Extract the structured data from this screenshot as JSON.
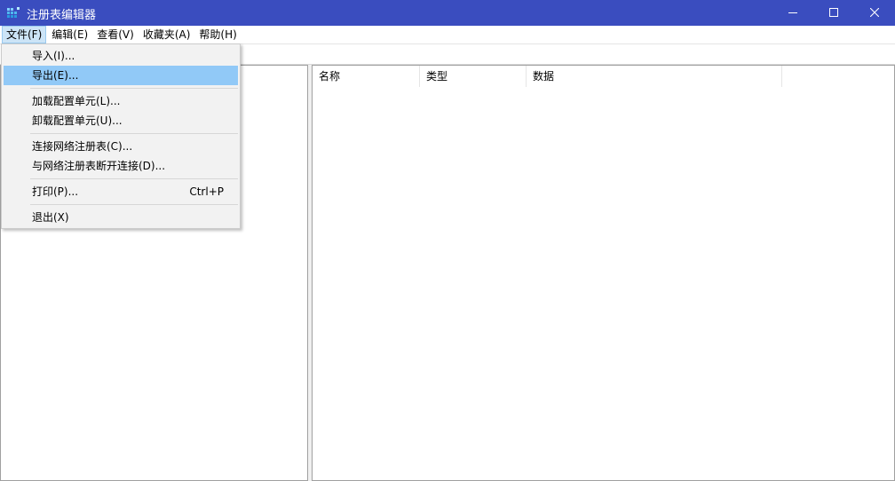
{
  "window": {
    "title": "注册表编辑器",
    "titlebar_color": "#3a4dbf",
    "icon": "registry-editor-icon"
  },
  "window_controls": {
    "minimize_icon": "minimize-icon",
    "maximize_icon": "maximize-icon",
    "close_icon": "close-icon"
  },
  "menubar": {
    "items": [
      {
        "label": "文件(F)",
        "active": true
      },
      {
        "label": "编辑(E)"
      },
      {
        "label": "查看(V)"
      },
      {
        "label": "收藏夹(A)"
      },
      {
        "label": "帮助(H)"
      }
    ]
  },
  "address": {
    "value": ""
  },
  "file_menu": {
    "items": [
      {
        "label": "导入(I)...",
        "shortcut": ""
      },
      {
        "label": "导出(E)...",
        "shortcut": "",
        "highlighted": true
      },
      {
        "label": "加载配置单元(L)...",
        "shortcut": ""
      },
      {
        "label": "卸载配置单元(U)...",
        "shortcut": ""
      },
      {
        "label": "连接网络注册表(C)...",
        "shortcut": ""
      },
      {
        "label": "与网络注册表断开连接(D)...",
        "shortcut": ""
      },
      {
        "label": "打印(P)...",
        "shortcut": "Ctrl+P"
      },
      {
        "label": "退出(X)",
        "shortcut": ""
      }
    ],
    "highlight_color": "#91c9f7"
  },
  "list": {
    "columns": [
      "名称",
      "类型",
      "数据"
    ]
  }
}
